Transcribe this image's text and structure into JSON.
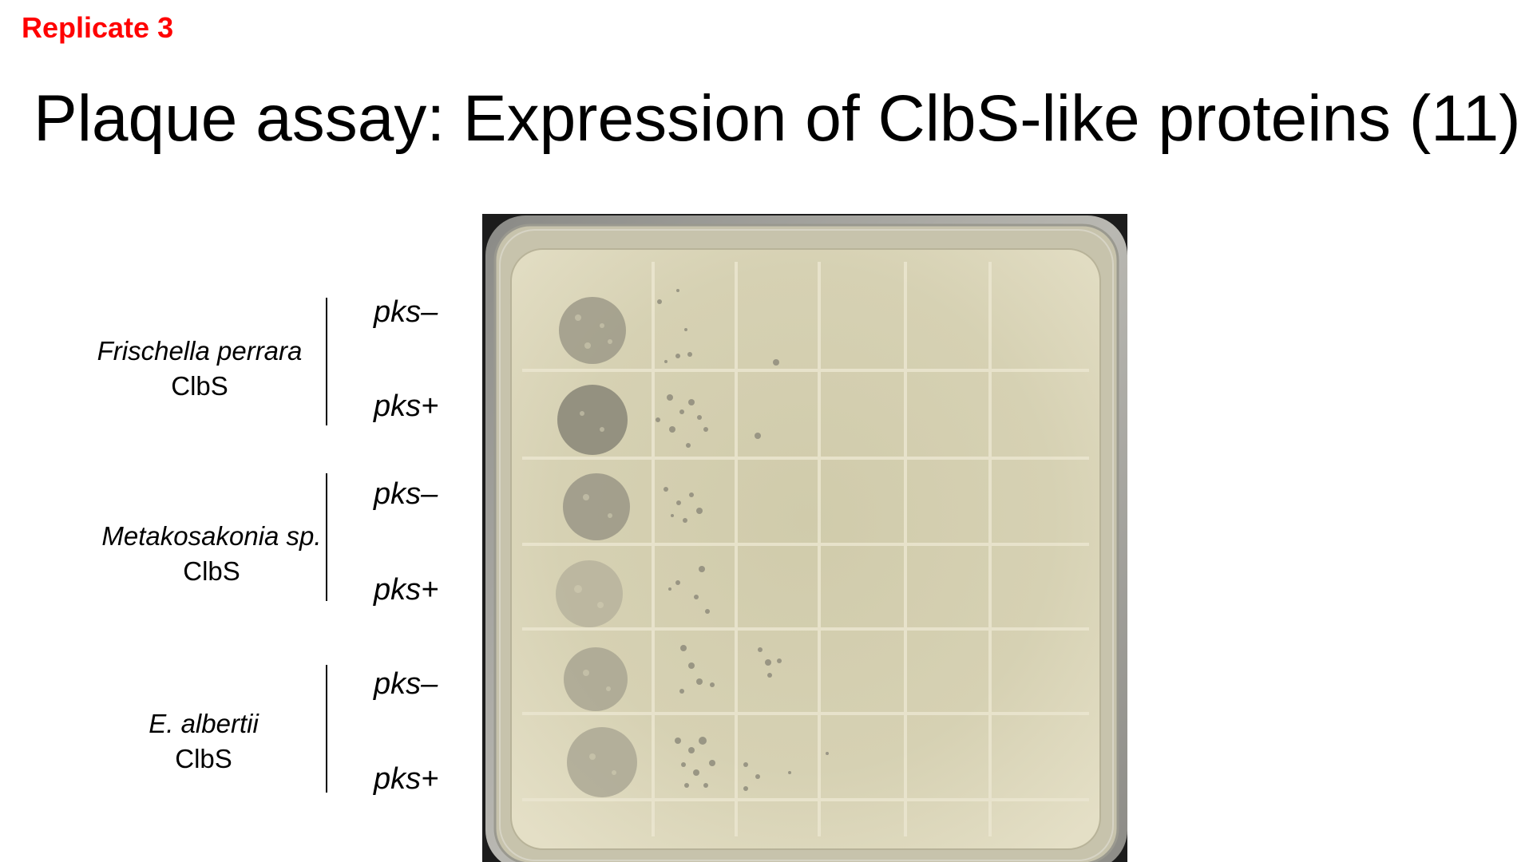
{
  "header": {
    "replicate_label": "Replicate 3",
    "title": "Plaque assay: Expression of ClbS-like proteins (11)"
  },
  "groups": [
    {
      "species": "Frischella perrara",
      "protein": "ClbS",
      "strains": [
        "pks–",
        "pks+"
      ]
    },
    {
      "species": "Metakosakonia sp.",
      "protein": "ClbS",
      "strains": [
        "pks–",
        "pks+"
      ]
    },
    {
      "species": "E. albertii",
      "protein": "ClbS",
      "strains": [
        "pks–",
        "pks+"
      ]
    }
  ],
  "colors": {
    "replicate": "#ff0000",
    "text": "#000000",
    "agar": "#d9d3b4"
  }
}
